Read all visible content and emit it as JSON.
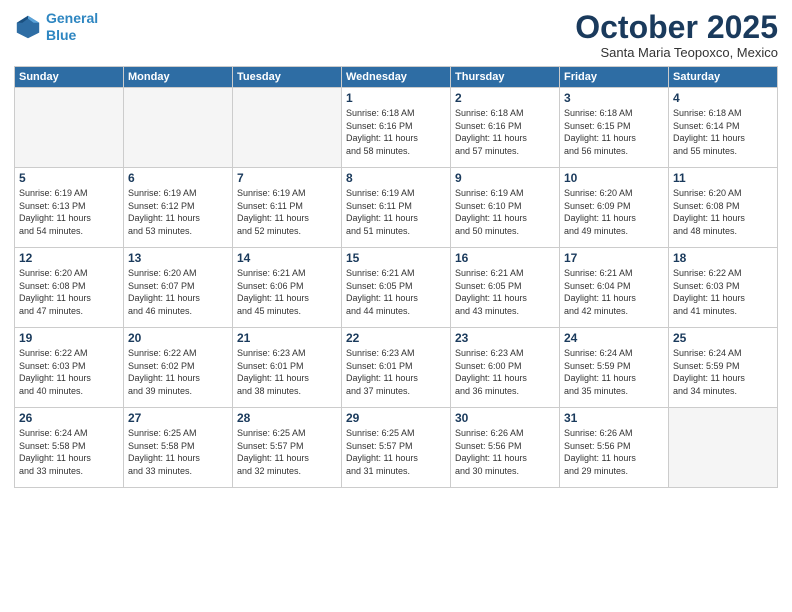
{
  "header": {
    "logo_line1": "General",
    "logo_line2": "Blue",
    "month": "October 2025",
    "location": "Santa Maria Teopoxco, Mexico"
  },
  "weekdays": [
    "Sunday",
    "Monday",
    "Tuesday",
    "Wednesday",
    "Thursday",
    "Friday",
    "Saturday"
  ],
  "weeks": [
    [
      {
        "day": "",
        "info": ""
      },
      {
        "day": "",
        "info": ""
      },
      {
        "day": "",
        "info": ""
      },
      {
        "day": "1",
        "info": "Sunrise: 6:18 AM\nSunset: 6:16 PM\nDaylight: 11 hours\nand 58 minutes."
      },
      {
        "day": "2",
        "info": "Sunrise: 6:18 AM\nSunset: 6:16 PM\nDaylight: 11 hours\nand 57 minutes."
      },
      {
        "day": "3",
        "info": "Sunrise: 6:18 AM\nSunset: 6:15 PM\nDaylight: 11 hours\nand 56 minutes."
      },
      {
        "day": "4",
        "info": "Sunrise: 6:18 AM\nSunset: 6:14 PM\nDaylight: 11 hours\nand 55 minutes."
      }
    ],
    [
      {
        "day": "5",
        "info": "Sunrise: 6:19 AM\nSunset: 6:13 PM\nDaylight: 11 hours\nand 54 minutes."
      },
      {
        "day": "6",
        "info": "Sunrise: 6:19 AM\nSunset: 6:12 PM\nDaylight: 11 hours\nand 53 minutes."
      },
      {
        "day": "7",
        "info": "Sunrise: 6:19 AM\nSunset: 6:11 PM\nDaylight: 11 hours\nand 52 minutes."
      },
      {
        "day": "8",
        "info": "Sunrise: 6:19 AM\nSunset: 6:11 PM\nDaylight: 11 hours\nand 51 minutes."
      },
      {
        "day": "9",
        "info": "Sunrise: 6:19 AM\nSunset: 6:10 PM\nDaylight: 11 hours\nand 50 minutes."
      },
      {
        "day": "10",
        "info": "Sunrise: 6:20 AM\nSunset: 6:09 PM\nDaylight: 11 hours\nand 49 minutes."
      },
      {
        "day": "11",
        "info": "Sunrise: 6:20 AM\nSunset: 6:08 PM\nDaylight: 11 hours\nand 48 minutes."
      }
    ],
    [
      {
        "day": "12",
        "info": "Sunrise: 6:20 AM\nSunset: 6:08 PM\nDaylight: 11 hours\nand 47 minutes."
      },
      {
        "day": "13",
        "info": "Sunrise: 6:20 AM\nSunset: 6:07 PM\nDaylight: 11 hours\nand 46 minutes."
      },
      {
        "day": "14",
        "info": "Sunrise: 6:21 AM\nSunset: 6:06 PM\nDaylight: 11 hours\nand 45 minutes."
      },
      {
        "day": "15",
        "info": "Sunrise: 6:21 AM\nSunset: 6:05 PM\nDaylight: 11 hours\nand 44 minutes."
      },
      {
        "day": "16",
        "info": "Sunrise: 6:21 AM\nSunset: 6:05 PM\nDaylight: 11 hours\nand 43 minutes."
      },
      {
        "day": "17",
        "info": "Sunrise: 6:21 AM\nSunset: 6:04 PM\nDaylight: 11 hours\nand 42 minutes."
      },
      {
        "day": "18",
        "info": "Sunrise: 6:22 AM\nSunset: 6:03 PM\nDaylight: 11 hours\nand 41 minutes."
      }
    ],
    [
      {
        "day": "19",
        "info": "Sunrise: 6:22 AM\nSunset: 6:03 PM\nDaylight: 11 hours\nand 40 minutes."
      },
      {
        "day": "20",
        "info": "Sunrise: 6:22 AM\nSunset: 6:02 PM\nDaylight: 11 hours\nand 39 minutes."
      },
      {
        "day": "21",
        "info": "Sunrise: 6:23 AM\nSunset: 6:01 PM\nDaylight: 11 hours\nand 38 minutes."
      },
      {
        "day": "22",
        "info": "Sunrise: 6:23 AM\nSunset: 6:01 PM\nDaylight: 11 hours\nand 37 minutes."
      },
      {
        "day": "23",
        "info": "Sunrise: 6:23 AM\nSunset: 6:00 PM\nDaylight: 11 hours\nand 36 minutes."
      },
      {
        "day": "24",
        "info": "Sunrise: 6:24 AM\nSunset: 5:59 PM\nDaylight: 11 hours\nand 35 minutes."
      },
      {
        "day": "25",
        "info": "Sunrise: 6:24 AM\nSunset: 5:59 PM\nDaylight: 11 hours\nand 34 minutes."
      }
    ],
    [
      {
        "day": "26",
        "info": "Sunrise: 6:24 AM\nSunset: 5:58 PM\nDaylight: 11 hours\nand 33 minutes."
      },
      {
        "day": "27",
        "info": "Sunrise: 6:25 AM\nSunset: 5:58 PM\nDaylight: 11 hours\nand 33 minutes."
      },
      {
        "day": "28",
        "info": "Sunrise: 6:25 AM\nSunset: 5:57 PM\nDaylight: 11 hours\nand 32 minutes."
      },
      {
        "day": "29",
        "info": "Sunrise: 6:25 AM\nSunset: 5:57 PM\nDaylight: 11 hours\nand 31 minutes."
      },
      {
        "day": "30",
        "info": "Sunrise: 6:26 AM\nSunset: 5:56 PM\nDaylight: 11 hours\nand 30 minutes."
      },
      {
        "day": "31",
        "info": "Sunrise: 6:26 AM\nSunset: 5:56 PM\nDaylight: 11 hours\nand 29 minutes."
      },
      {
        "day": "",
        "info": ""
      }
    ]
  ]
}
